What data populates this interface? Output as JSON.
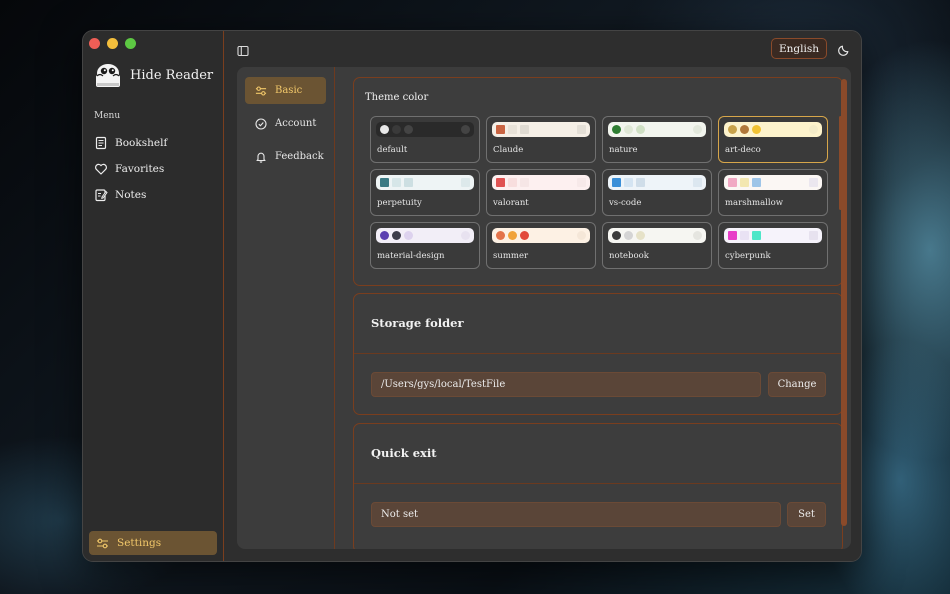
{
  "app": {
    "name": "Hide Reader"
  },
  "sidebar": {
    "menu_label": "Menu",
    "items": [
      {
        "label": "Bookshelf",
        "icon": "book-icon"
      },
      {
        "label": "Favorites",
        "icon": "heart-icon"
      },
      {
        "label": "Notes",
        "icon": "note-icon"
      }
    ],
    "settings_label": "Settings"
  },
  "header": {
    "language": "English"
  },
  "subnav": {
    "items": [
      {
        "label": "Basic",
        "icon": "sliders-icon",
        "active": true
      },
      {
        "label": "Account",
        "icon": "check-circle-icon",
        "active": false
      },
      {
        "label": "Feedback",
        "icon": "bell-icon",
        "active": false
      }
    ]
  },
  "theme": {
    "title": "Theme color",
    "selected": "art-deco",
    "options": [
      {
        "name": "default",
        "bar": "#2a2a2a",
        "marks": [
          "#e8e8e8",
          "#3a3a3a",
          "#444444"
        ],
        "end": "#444444",
        "shape": "dot"
      },
      {
        "name": "Claude",
        "bar": "#f5efe6",
        "marks": [
          "#c96442",
          "#e8e2d8",
          "#e0dbd2"
        ],
        "end": "#e4dfd6",
        "shape": "sq"
      },
      {
        "name": "nature",
        "bar": "#f2f5ee",
        "marks": [
          "#2e7d32",
          "#dfe8d6",
          "#cfe0c4"
        ],
        "end": "#e2e8dc",
        "shape": "dot"
      },
      {
        "name": "art-deco",
        "bar": "#fdf3cc",
        "marks": [
          "#c8a24a",
          "#b0783a",
          "#f1c232"
        ],
        "end": "#f4ecc8",
        "shape": "dot"
      },
      {
        "name": "perpetuity",
        "bar": "#eef4f5",
        "marks": [
          "#3a7a84",
          "#d6e6e8",
          "#cddfe2"
        ],
        "end": "#dde9eb",
        "shape": "sq"
      },
      {
        "name": "valorant",
        "bar": "#fdf0f0",
        "marks": [
          "#e05252",
          "#f8dede",
          "#f6e6e6"
        ],
        "end": "#f7e9e9",
        "shape": "sq"
      },
      {
        "name": "vs-code",
        "bar": "#eef4f9",
        "marks": [
          "#3a8fd8",
          "#d4e4f2",
          "#cfdde9"
        ],
        "end": "#dce7f0",
        "shape": "sq"
      },
      {
        "name": "marshmallow",
        "bar": "#fbf7f4",
        "marks": [
          "#f1a9c4",
          "#f3e7b0",
          "#9ec5e8"
        ],
        "end": "#ebe7ef",
        "shape": "sq"
      },
      {
        "name": "material-design",
        "bar": "#f2eef7",
        "marks": [
          "#5b3fb0",
          "#3c3c4a",
          "#ddd2ee"
        ],
        "end": "#e8e2f0",
        "shape": "dot"
      },
      {
        "name": "summer",
        "bar": "#fdf1e4",
        "marks": [
          "#e3734a",
          "#f0a23a",
          "#e24a3a"
        ],
        "end": "#f5e7d8",
        "shape": "dot"
      },
      {
        "name": "notebook",
        "bar": "#f6f6f2",
        "marks": [
          "#3a3a3a",
          "#d4d4d4",
          "#e6e2c8"
        ],
        "end": "#e5e5e0",
        "shape": "dot"
      },
      {
        "name": "cyberpunk",
        "bar": "#f6f3fb",
        "marks": [
          "#e83ec8",
          "#e9e2f4",
          "#4ee6c8"
        ],
        "end": "#e7e2ef",
        "shape": "sq"
      }
    ]
  },
  "storage": {
    "title": "Storage folder",
    "path": "/Users/gys/local/TestFile",
    "button": "Change"
  },
  "quick_exit": {
    "title": "Quick exit",
    "value": "Not set",
    "button": "Set"
  },
  "colors": {
    "accent": "#f2c86a",
    "border_accent": "#7a3e1e",
    "active_bg": "#6b5433"
  }
}
